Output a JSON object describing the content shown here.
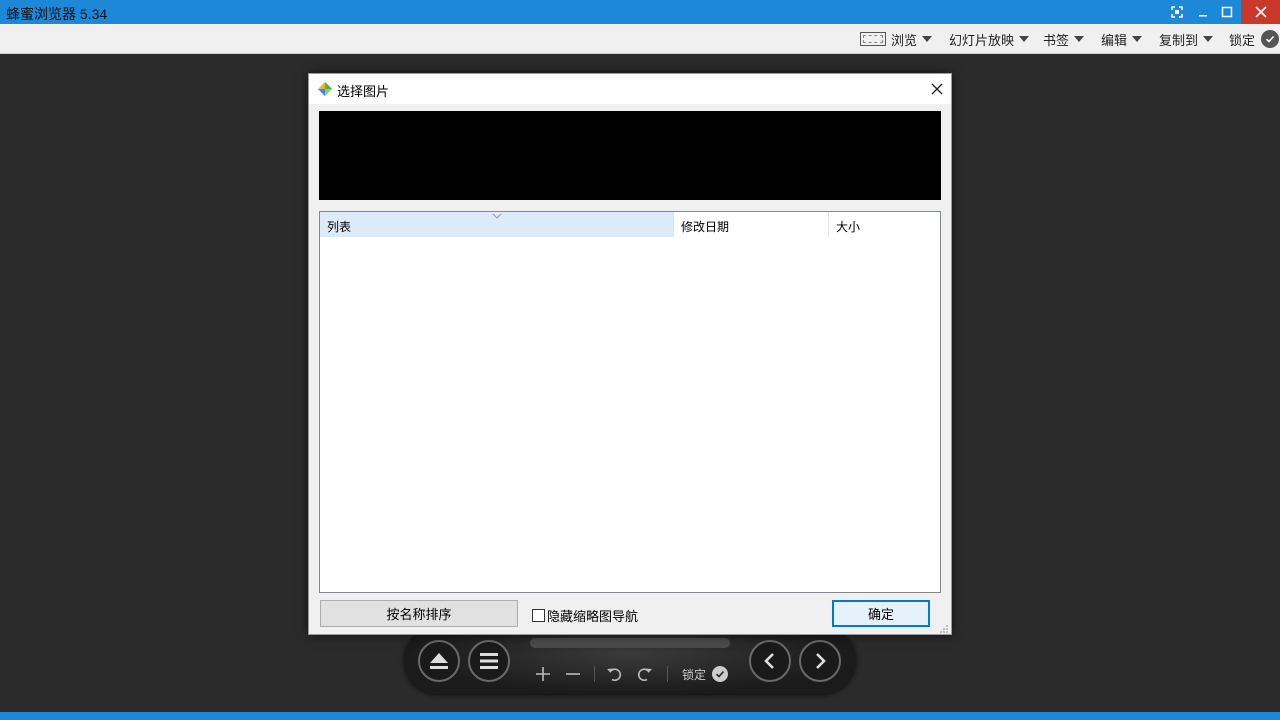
{
  "window": {
    "title": "蜂蜜浏览器 5.34",
    "colors": {
      "titlebar": "#1e88d8",
      "close": "#c8392b",
      "background": "#2b2b2b"
    }
  },
  "toolbar": {
    "browse": "浏览",
    "slideshow": "幻灯片放映",
    "bookmarks": "书签",
    "edit": "编辑",
    "copy_to": "复制到",
    "lock": "锁定"
  },
  "dialog": {
    "title": "选择图片",
    "list": {
      "columns": [
        "列表",
        "修改日期",
        "大小"
      ],
      "rows": []
    },
    "sort_button": "按名称排序",
    "hide_thumbnail_nav": {
      "label": "隐藏缩略图导航",
      "checked": false
    },
    "ok_button": "确定"
  },
  "controls": {
    "lock_label": "锁定",
    "icons": [
      "eject-icon",
      "menu-icon",
      "zoom-in-icon",
      "zoom-out-icon",
      "rotate-left-icon",
      "rotate-right-icon",
      "check-icon",
      "previous-icon",
      "next-icon"
    ]
  }
}
